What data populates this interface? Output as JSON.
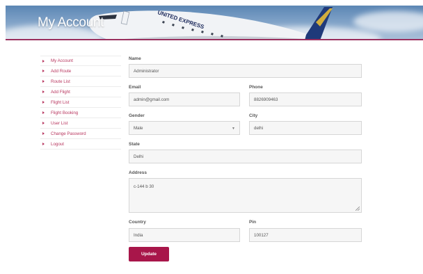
{
  "header": {
    "title": "My Account",
    "plane_livery": "UNITED EXPRESS"
  },
  "sidebar": {
    "items": [
      {
        "label": "My Account"
      },
      {
        "label": "Add Route"
      },
      {
        "label": "Route List"
      },
      {
        "label": "Add Flight"
      },
      {
        "label": "Flight List"
      },
      {
        "label": "Flight Booking"
      },
      {
        "label": "User List"
      },
      {
        "label": "Change Password"
      },
      {
        "label": "Logout"
      }
    ]
  },
  "form": {
    "name": {
      "label": "Name",
      "value": "Administrator"
    },
    "email": {
      "label": "Email",
      "value": "admin@gmail.com"
    },
    "phone": {
      "label": "Phone",
      "value": "8826909463"
    },
    "gender": {
      "label": "Gender",
      "value": "Male"
    },
    "city": {
      "label": "City",
      "value": "delhi"
    },
    "state": {
      "label": "State",
      "value": "Delhi"
    },
    "address": {
      "label": "Address",
      "value": "c-144 b 30"
    },
    "country": {
      "label": "Country",
      "value": "India"
    },
    "pin": {
      "label": "Pin",
      "value": "100127"
    },
    "submit_label": "Update"
  },
  "colors": {
    "accent": "#a8164a",
    "link": "#b8365f",
    "banner_sky": "#5b86b4"
  },
  "icons": {
    "sidebar_bullet": "triangle-right-icon",
    "select_caret": "chevron-down-icon",
    "resize": "resize-grip-icon"
  }
}
